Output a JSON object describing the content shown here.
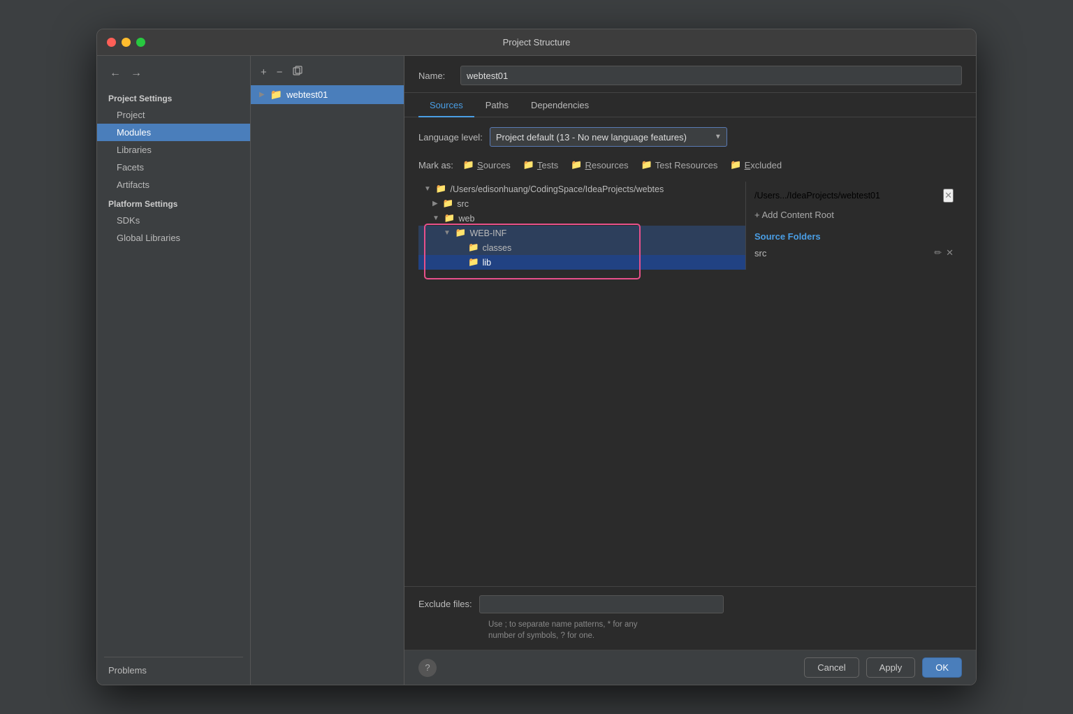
{
  "window": {
    "title": "Project Structure"
  },
  "sidebar": {
    "project_settings_header": "Project Settings",
    "items": [
      {
        "label": "Project",
        "active": false
      },
      {
        "label": "Modules",
        "active": true
      },
      {
        "label": "Libraries",
        "active": false
      },
      {
        "label": "Facets",
        "active": false
      },
      {
        "label": "Artifacts",
        "active": false
      }
    ],
    "platform_settings_header": "Platform Settings",
    "platform_items": [
      {
        "label": "SDKs",
        "active": false
      },
      {
        "label": "Global Libraries",
        "active": false
      }
    ],
    "problems": "Problems"
  },
  "module_tree": {
    "buttons": {
      "add": "+",
      "remove": "−",
      "copy": "⊞"
    },
    "items": [
      {
        "label": "webtest01",
        "selected": true
      }
    ]
  },
  "name_field": {
    "label": "Name:",
    "value": "webtest01"
  },
  "tabs": [
    {
      "label": "Sources",
      "active": true
    },
    {
      "label": "Paths",
      "active": false
    },
    {
      "label": "Dependencies",
      "active": false
    }
  ],
  "language_level": {
    "label": "Language level:",
    "value": "Project default (13 - No new language features)"
  },
  "mark_as": {
    "label": "Mark as:",
    "buttons": [
      {
        "label": "Sources",
        "icon": "📁",
        "color": "blue"
      },
      {
        "label": "Tests",
        "icon": "📁",
        "color": "green"
      },
      {
        "label": "Resources",
        "icon": "📁",
        "color": "blue"
      },
      {
        "label": "Test Resources",
        "icon": "📁",
        "color": "green"
      },
      {
        "label": "Excluded",
        "icon": "📁",
        "color": "orange"
      }
    ]
  },
  "file_tree": {
    "root_path": "/Users/edisonhuang/CodingSpace/IdeaProjects/webtes",
    "items": [
      {
        "label": "src",
        "indent": 1,
        "type": "folder"
      },
      {
        "label": "web",
        "indent": 1,
        "type": "folder"
      },
      {
        "label": "WEB-INF",
        "indent": 2,
        "type": "folder",
        "highlighted": true
      },
      {
        "label": "classes",
        "indent": 3,
        "type": "folder",
        "highlighted": true
      },
      {
        "label": "lib",
        "indent": 3,
        "type": "folder",
        "selected": true
      }
    ]
  },
  "source_panel": {
    "path": "/Users.../IdeaProjects/webtest01",
    "add_content_root": "+ Add Content Root",
    "source_folders_title": "Source Folders",
    "src_item": "src"
  },
  "exclude_files": {
    "label": "Exclude files:",
    "placeholder": "",
    "hint": "Use ; to separate name patterns, * for any\nnumber of symbols, ? for one."
  },
  "footer": {
    "cancel_label": "Cancel",
    "apply_label": "Apply",
    "ok_label": "OK"
  }
}
